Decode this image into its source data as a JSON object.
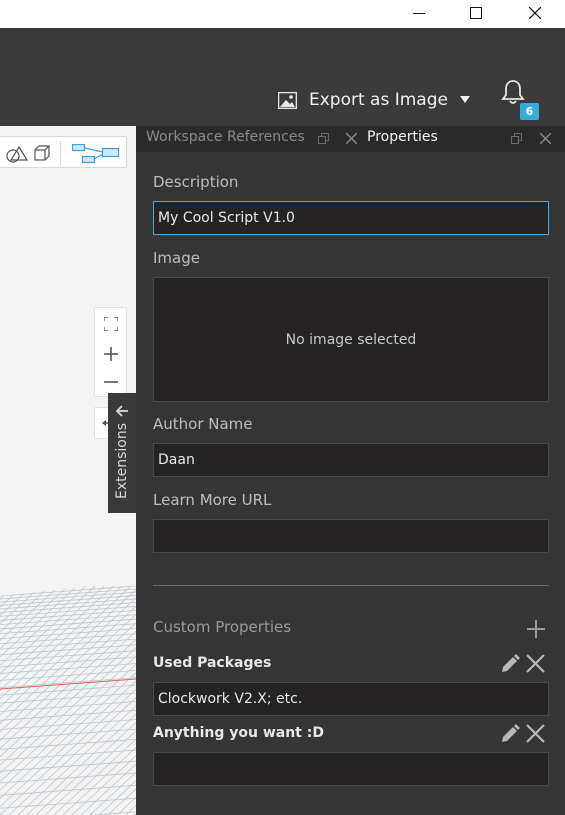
{
  "window": {
    "controls": [
      "minimize",
      "maximize",
      "close"
    ]
  },
  "header": {
    "export_label": "Export as Image",
    "notification_count": "6"
  },
  "canvas": {
    "extensions_label": "Extensions",
    "zoom_in_symbol": "+",
    "zoom_out_symbol": "−"
  },
  "tabs": {
    "workspace_references": "Workspace References",
    "properties": "Properties"
  },
  "properties": {
    "description_label": "Description",
    "description_value": "My Cool Script V1.0",
    "image_label": "Image",
    "image_placeholder": "No image selected",
    "author_label": "Author Name",
    "author_value": "Daan",
    "url_label": "Learn More URL",
    "url_value": "",
    "custom_label": "Custom Properties",
    "custom_properties": [
      {
        "name": "Used Packages",
        "value": "Clockwork V2.X; etc."
      },
      {
        "name": "Anything you want :D",
        "value": ""
      }
    ]
  },
  "colors": {
    "accent": "#38abdf",
    "panel_bg": "#353535",
    "field_bg": "#252324",
    "canvas_bg": "#f4f4f4"
  }
}
